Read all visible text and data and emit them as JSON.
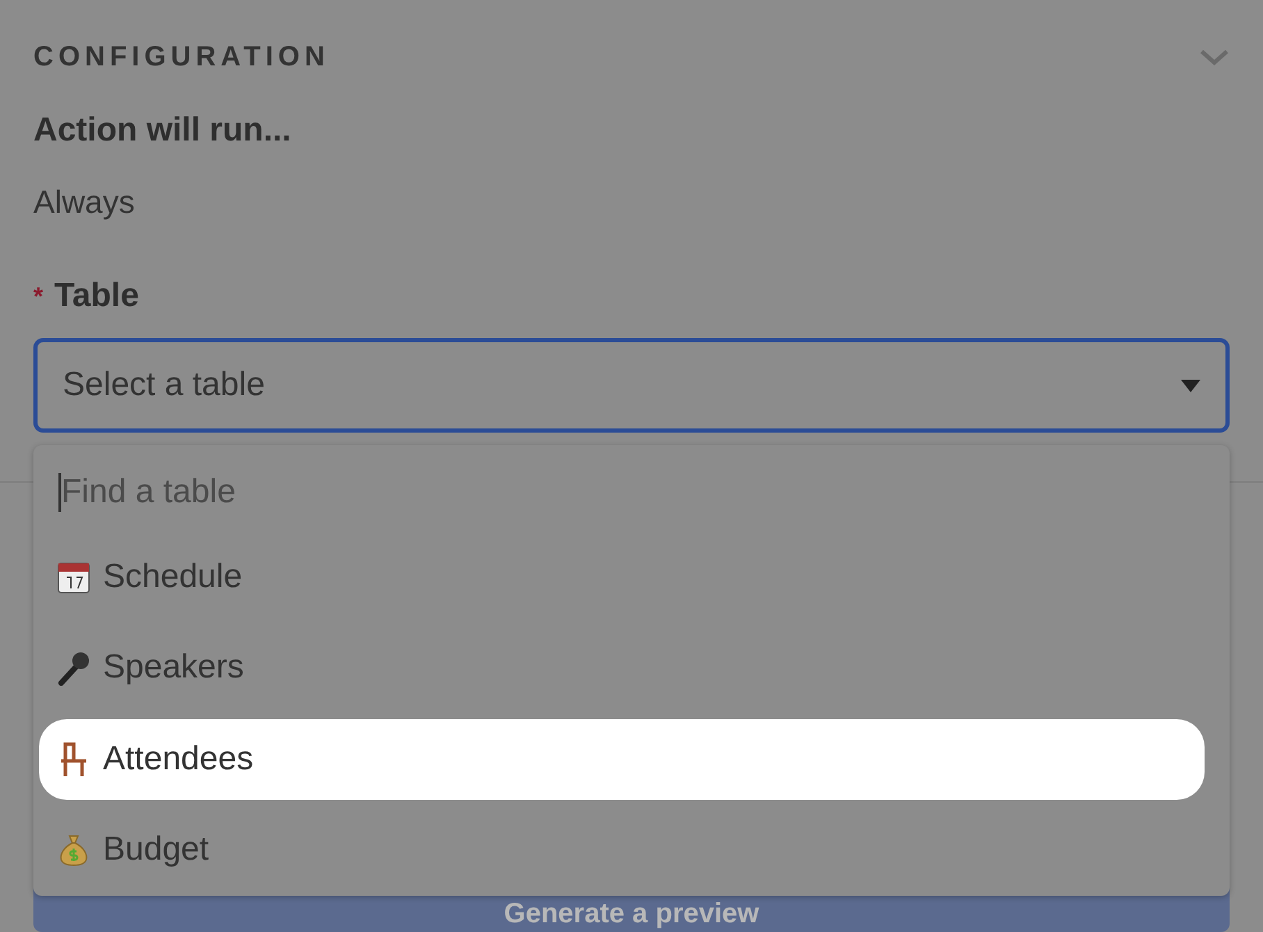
{
  "section": {
    "title": "CONFIGURATION",
    "expanded": true
  },
  "run_label": "Action will run...",
  "run_value": "Always",
  "table_field": {
    "required_mark": "*",
    "label": "Table",
    "placeholder": "Select a table"
  },
  "dropdown": {
    "search_placeholder": "Find a table",
    "items": [
      {
        "kind": "calendar",
        "label": "Schedule",
        "selected": false
      },
      {
        "kind": "microphone",
        "label": "Speakers",
        "selected": false
      },
      {
        "kind": "chair",
        "label": "Attendees",
        "selected": true
      },
      {
        "kind": "moneybag",
        "label": "Budget",
        "selected": false
      }
    ]
  },
  "preview_button": {
    "label": "Generate a preview"
  }
}
